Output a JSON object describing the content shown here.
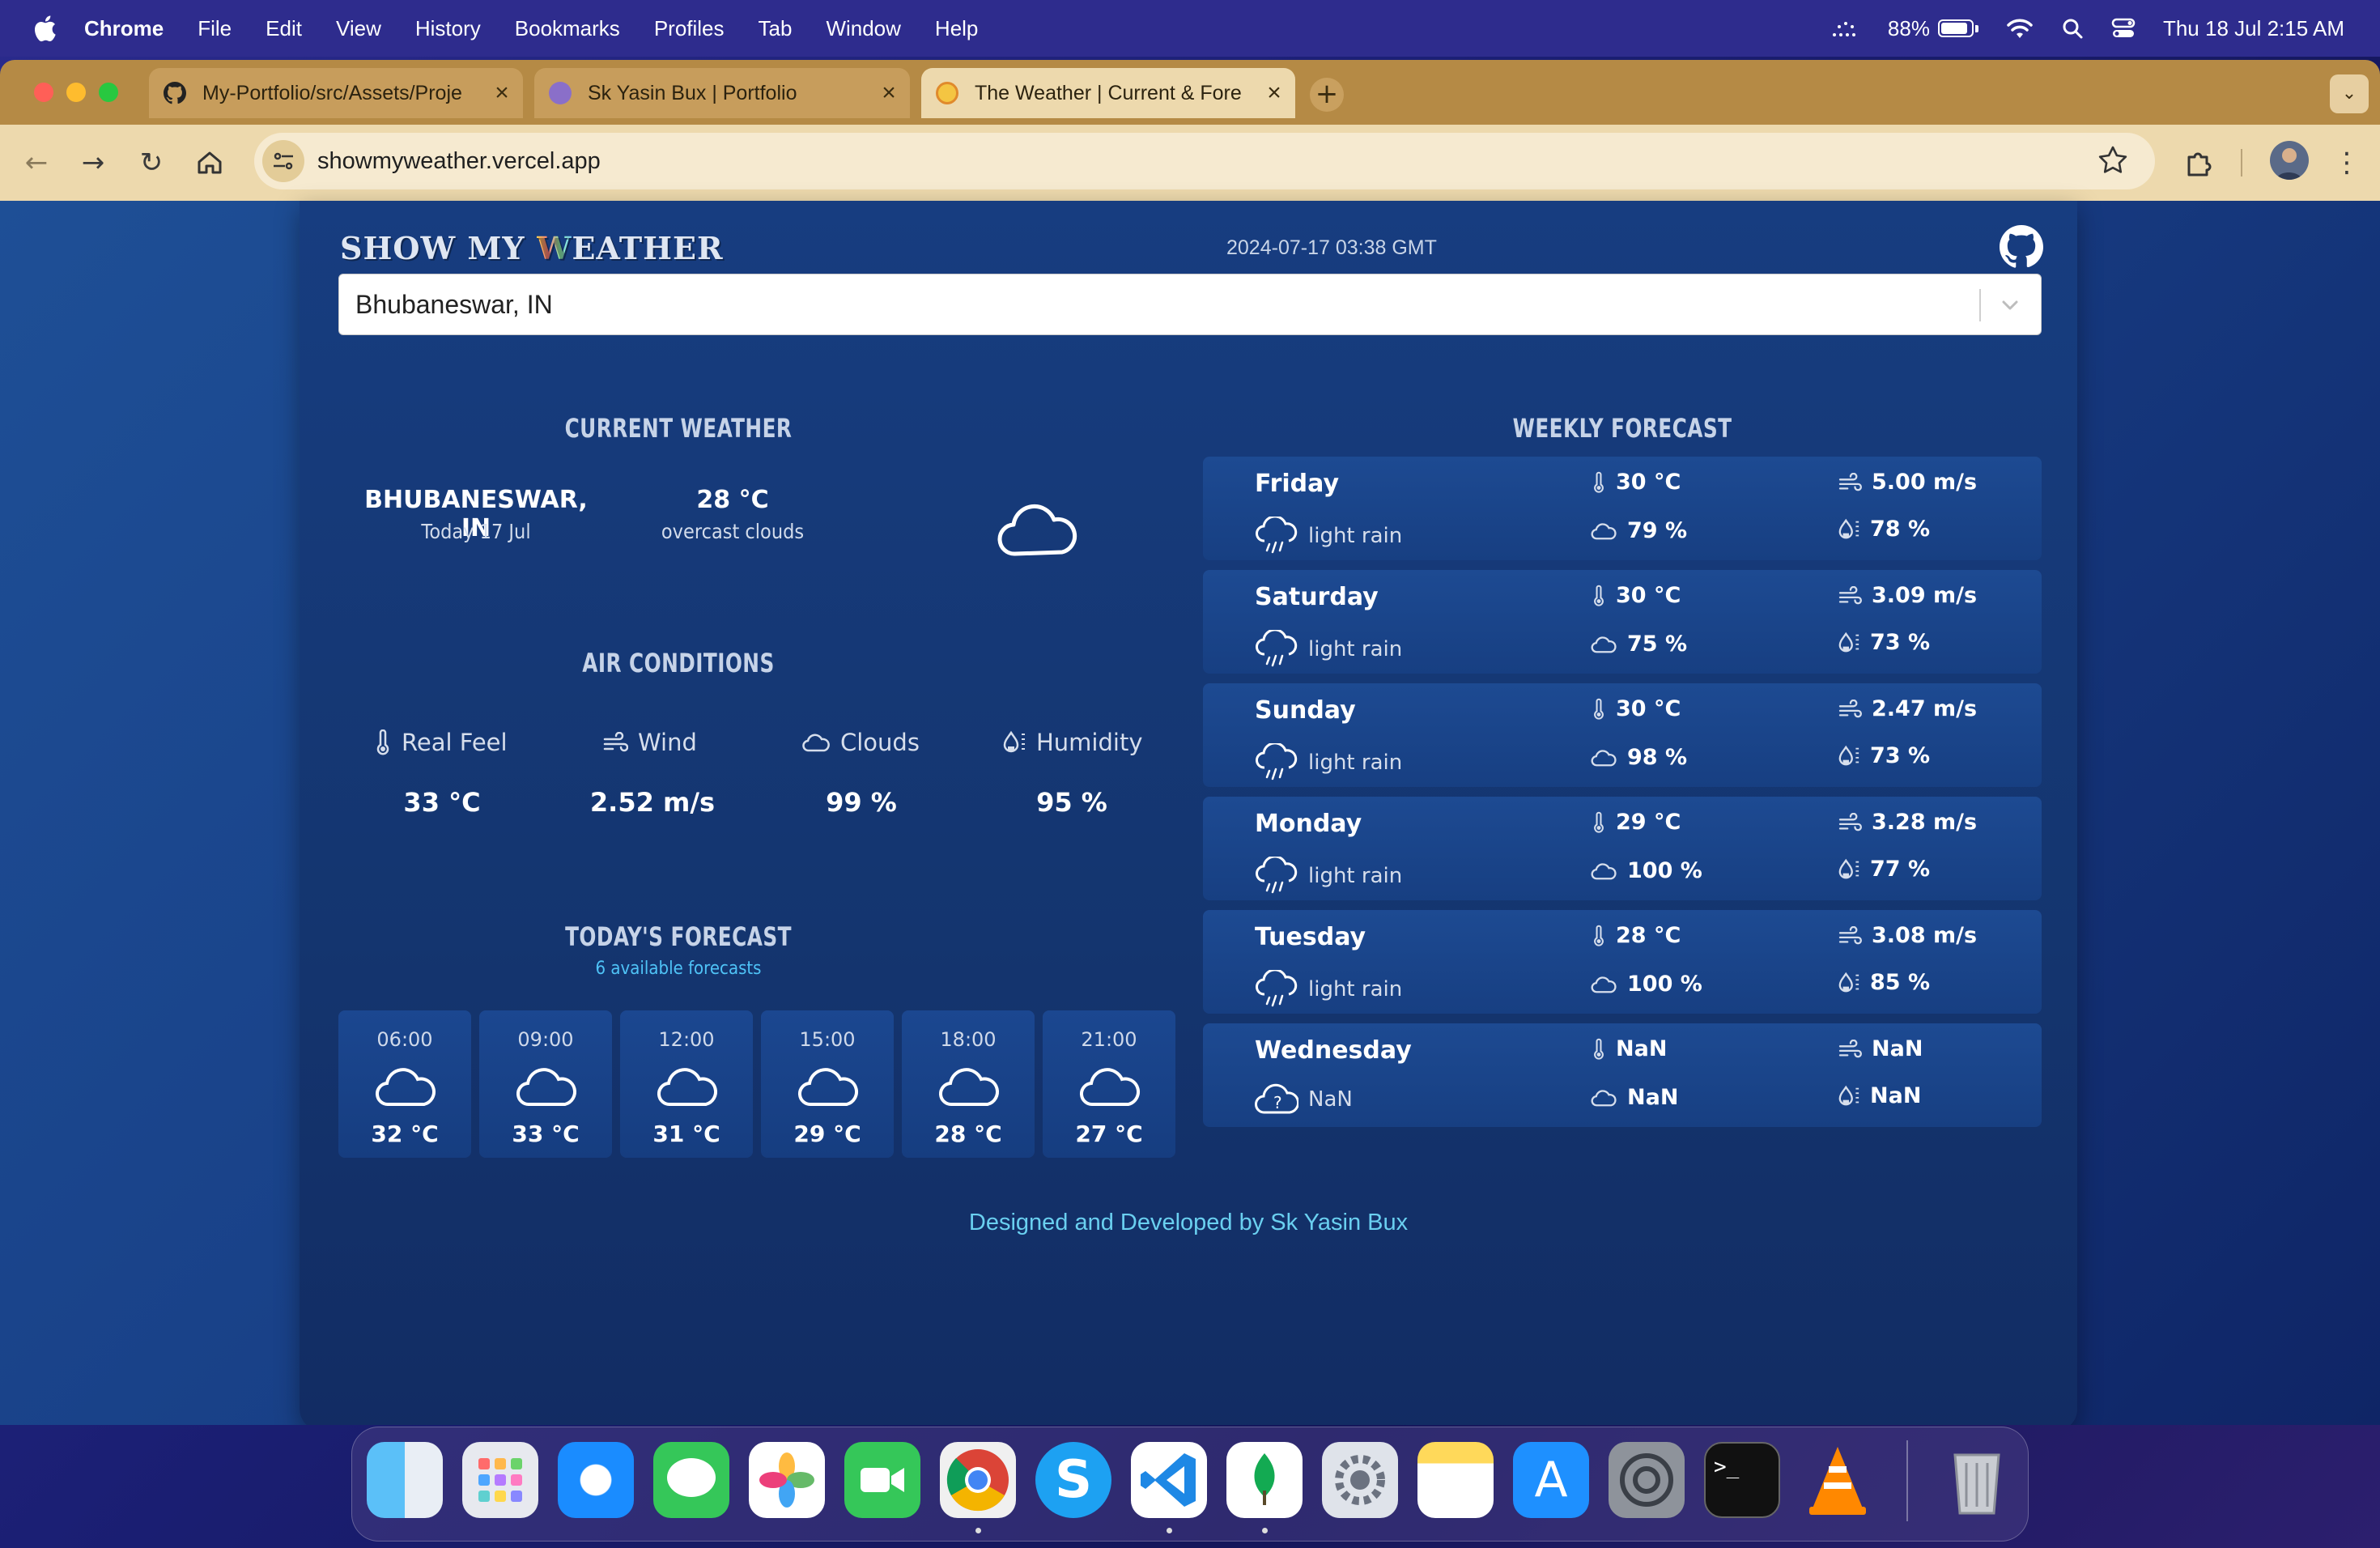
{
  "menubar": {
    "app": "Chrome",
    "items": [
      "File",
      "Edit",
      "View",
      "History",
      "Bookmarks",
      "Profiles",
      "Tab",
      "Window",
      "Help"
    ],
    "battery": "88%",
    "battery_level": 0.88,
    "clock": "Thu 18 Jul  2:15 AM"
  },
  "browser": {
    "tabs": [
      {
        "title": "My-Portfolio/src/Assets/Proje",
        "active": false
      },
      {
        "title": "Sk Yasin Bux | Portfolio",
        "active": false
      },
      {
        "title": "The Weather | Current & Fore",
        "active": true
      }
    ],
    "url": "showmyweather.vercel.app"
  },
  "header": {
    "logo_a": "SHOW MY ",
    "logo_w": "W",
    "logo_b": "EATHER",
    "datetime": "2024-07-17 03:38 GMT"
  },
  "search": {
    "value": "Bhubaneswar, IN"
  },
  "current": {
    "title": "CURRENT WEATHER",
    "city": "BHUBANESWAR, IN",
    "date": "Today 17 Jul",
    "temp": "28 °C",
    "desc": "overcast clouds",
    "icon": "cloud-icon"
  },
  "air": {
    "title": "AIR CONDITIONS",
    "items": [
      {
        "label": "Real Feel",
        "value": "33 °C",
        "icon": "thermometer-icon"
      },
      {
        "label": "Wind",
        "value": "2.52 m/s",
        "icon": "wind-icon"
      },
      {
        "label": "Clouds",
        "value": "99 %",
        "icon": "cloud-icon"
      },
      {
        "label": "Humidity",
        "value": "95 %",
        "icon": "humidity-icon"
      }
    ]
  },
  "today": {
    "title": "TODAY'S FORECAST",
    "subtitle": "6 available forecasts",
    "hours": [
      {
        "time": "06:00",
        "temp": "32 °C"
      },
      {
        "time": "09:00",
        "temp": "33 °C"
      },
      {
        "time": "12:00",
        "temp": "31 °C"
      },
      {
        "time": "15:00",
        "temp": "29 °C"
      },
      {
        "time": "18:00",
        "temp": "28 °C"
      },
      {
        "time": "21:00",
        "temp": "27 °C"
      }
    ]
  },
  "weekly": {
    "title": "WEEKLY FORECAST",
    "days": [
      {
        "day": "Friday",
        "desc": "light rain",
        "temp": "30 °C",
        "wind": "5.00 m/s",
        "clouds": "79 %",
        "humidity": "78 %"
      },
      {
        "day": "Saturday",
        "desc": "light rain",
        "temp": "30 °C",
        "wind": "3.09 m/s",
        "clouds": "75 %",
        "humidity": "73 %"
      },
      {
        "day": "Sunday",
        "desc": "light rain",
        "temp": "30 °C",
        "wind": "2.47 m/s",
        "clouds": "98 %",
        "humidity": "73 %"
      },
      {
        "day": "Monday",
        "desc": "light rain",
        "temp": "29 °C",
        "wind": "3.28 m/s",
        "clouds": "100 %",
        "humidity": "77 %"
      },
      {
        "day": "Tuesday",
        "desc": "light rain",
        "temp": "28 °C",
        "wind": "3.08 m/s",
        "clouds": "100 %",
        "humidity": "85 %"
      },
      {
        "day": "Wednesday",
        "desc": "NaN",
        "temp": "NaN",
        "wind": "NaN",
        "clouds": "NaN",
        "humidity": "NaN"
      }
    ]
  },
  "footer": "Designed and Developed by Sk Yasin Bux",
  "dock": [
    "finder-icon",
    "launchpad-icon",
    "safari-icon",
    "messages-icon",
    "photos-icon",
    "facetime-icon",
    "chrome-icon",
    "skype-icon",
    "vscode-icon",
    "mongodb-compass-icon",
    "system-settings-icon",
    "notes-icon",
    "app-store-icon",
    "settings-gear-icon",
    "terminal-icon",
    "vlc-icon",
    "trash-icon"
  ],
  "colors": {
    "menubar": "#2e2c8d",
    "tabstrip": "#b58a45",
    "toolbar": "#edd9ad",
    "card": "#173d80",
    "accent": "#4fc3f7"
  }
}
